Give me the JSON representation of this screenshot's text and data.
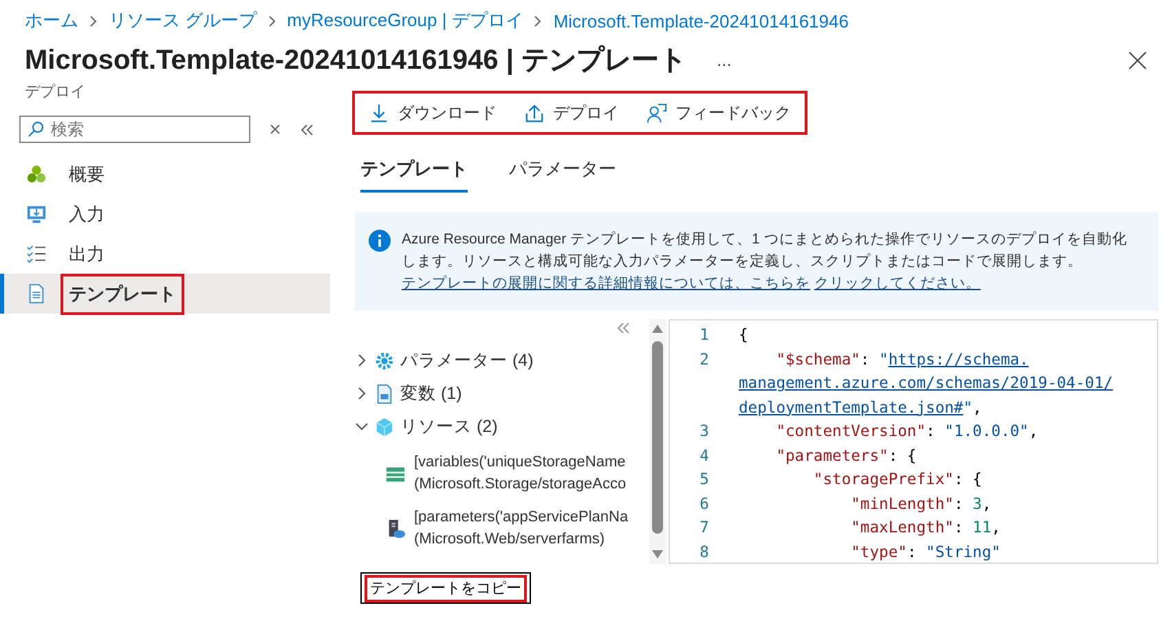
{
  "breadcrumb": [
    "ホーム",
    "リソース グループ",
    "myResourceGroup | デプロイ",
    "Microsoft.Template-20241014161946"
  ],
  "title": "Microsoft.Template-20241014161946 | テンプレート",
  "more": "...",
  "subtitle": "デプロイ",
  "search": {
    "placeholder": "検索"
  },
  "sidebar": {
    "items": [
      {
        "label": "概要",
        "selected": false,
        "highlighted": false
      },
      {
        "label": "入力",
        "selected": false,
        "highlighted": false
      },
      {
        "label": "出力",
        "selected": false,
        "highlighted": false
      },
      {
        "label": "テンプレート",
        "selected": true,
        "highlighted": true
      }
    ]
  },
  "toolbar": {
    "highlighted": true,
    "buttons": [
      {
        "label": "ダウンロード"
      },
      {
        "label": "デプロイ"
      },
      {
        "label": "フィードバック"
      }
    ]
  },
  "tabs": [
    {
      "label": "テンプレート",
      "selected": true
    },
    {
      "label": "パラメーター",
      "selected": false
    }
  ],
  "info": {
    "text": "Azure Resource Manager テンプレートを使用して、1 つにまとめられた操作でリソースのデプロイを自動化します。リソースと構成可能な入力パラメーターを定義し、スクリプトまたはコードで展開します。",
    "link_lines": [
      "テンプレートの展開に関する詳細情報については、こちらを",
      "クリックしてください。"
    ]
  },
  "tree": [
    {
      "label": "パラメーター (4)",
      "expanded": false
    },
    {
      "label": "変数 (1)",
      "expanded": false
    },
    {
      "label": "リソース (2)",
      "expanded": true,
      "children": [
        {
          "line1": "[variables('uniqueStorageName",
          "line2": "(Microsoft.Storage/storageAcco"
        },
        {
          "line1": "[parameters('appServicePlanNa",
          "line2": "(Microsoft.Web/serverfarms)"
        }
      ]
    }
  ],
  "code": [
    {
      "number": "1",
      "tokens": [
        {
          "kind": "punct",
          "text": "{"
        }
      ]
    },
    {
      "number": "2",
      "tokens": [
        {
          "kind": "key",
          "text": "    \"$schema\""
        },
        {
          "kind": "punct",
          "text": ": "
        },
        {
          "kind": "string",
          "text": "\""
        },
        {
          "kind": "link",
          "text": "https://schema."
        }
      ]
    },
    {
      "tokens": [
        {
          "kind": "link",
          "text": "management.azure.com/schemas/2019-04-01/"
        }
      ]
    },
    {
      "tokens": [
        {
          "kind": "link",
          "text": "deploymentTemplate.json#"
        },
        {
          "kind": "string",
          "text": "\""
        },
        {
          "kind": "punct",
          "text": ","
        }
      ]
    },
    {
      "number": "3",
      "tokens": [
        {
          "kind": "key",
          "text": "    \"contentVersion\""
        },
        {
          "kind": "punct",
          "text": ": "
        },
        {
          "kind": "string",
          "text": "\"1.0.0.0\""
        },
        {
          "kind": "punct",
          "text": ","
        }
      ]
    },
    {
      "number": "4",
      "tokens": [
        {
          "kind": "key",
          "text": "    \"parameters\""
        },
        {
          "kind": "punct",
          "text": ": {"
        }
      ]
    },
    {
      "number": "5",
      "tokens": [
        {
          "kind": "key",
          "text": "        \"storagePrefix\""
        },
        {
          "kind": "punct",
          "text": ": {"
        }
      ]
    },
    {
      "number": "6",
      "tokens": [
        {
          "kind": "key",
          "text": "            \"minLength\""
        },
        {
          "kind": "punct",
          "text": ": "
        },
        {
          "kind": "number",
          "text": "3"
        },
        {
          "kind": "punct",
          "text": ","
        }
      ]
    },
    {
      "number": "7",
      "tokens": [
        {
          "kind": "key",
          "text": "            \"maxLength\""
        },
        {
          "kind": "punct",
          "text": ": "
        },
        {
          "kind": "number",
          "text": "11"
        },
        {
          "kind": "punct",
          "text": ","
        }
      ]
    },
    {
      "number": "8",
      "tokens": [
        {
          "kind": "key",
          "text": "            \"type\""
        },
        {
          "kind": "punct",
          "text": ": "
        },
        {
          "kind": "string",
          "text": "\"String\""
        }
      ]
    }
  ],
  "copy_button": {
    "label": "テンプレートをコピー",
    "highlighted": true
  }
}
